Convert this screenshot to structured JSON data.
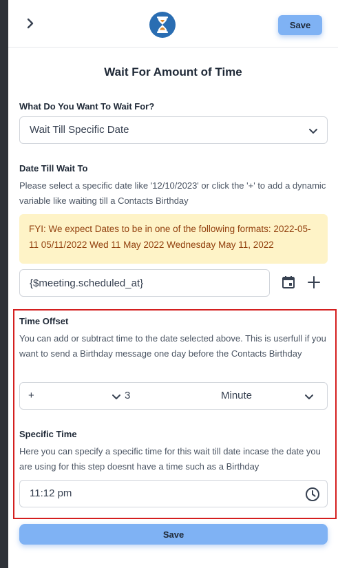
{
  "header": {
    "save_label": "Save"
  },
  "title": "Wait For Amount of Time",
  "wait_for": {
    "label": "What Do You Want To Wait For?",
    "selected": "Wait Till Specific Date"
  },
  "date_till": {
    "label": "Date Till Wait To",
    "help": "Please select a specific date like '12/10/2023' or click the '+' to add a dynamic variable like waiting till a Contacts Birthday",
    "fyi": "FYI: We expect Dates to be in one of the following formats: 2022-05-11 05/11/2022 Wed 11 May 2022 Wednesday May 11, 2022",
    "value": "{$meeting.scheduled_at}"
  },
  "time_offset": {
    "label": "Time Offset",
    "help": "You can add or subtract time to the date selected above. This is userfull if you want to send a Birthday message one day before the Contacts Birthday",
    "operator": "+",
    "amount": "3",
    "unit": "Minute"
  },
  "specific_time": {
    "label": "Specific Time",
    "help": "Here you can specify a specific time for this wait till date incase the date you are using for this step doesnt have a time such as a Birthday",
    "value": "11:12 pm"
  },
  "footer": {
    "save_label": "Save"
  },
  "colors": {
    "accent": "#7fb2f4",
    "fyi_background": "#fef3c7",
    "highlight_border": "#d41f1f"
  }
}
